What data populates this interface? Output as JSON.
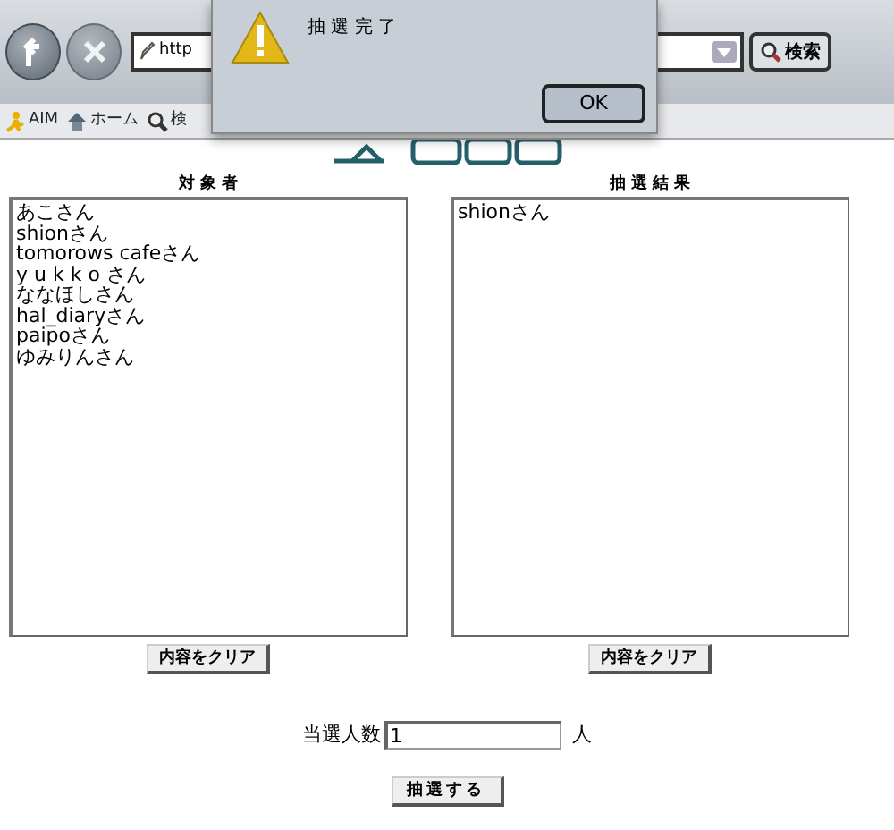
{
  "browser": {
    "address": "http",
    "search_button": "検索",
    "bookmarks": [
      {
        "label": "AIM",
        "kind": "runner"
      },
      {
        "label": "ホーム",
        "kind": "home"
      },
      {
        "label": "検",
        "kind": "search"
      }
    ]
  },
  "dialog": {
    "message": "抽 選 完 了",
    "button": "OK"
  },
  "candidates": {
    "heading": "対 象 者",
    "names": [
      "あこさん",
      "shionさん",
      "tomorows cafeさん",
      "y u k k o さん",
      "ななほしさん",
      "hal_diaryさん",
      "paipoさん",
      "ゆみりんさん"
    ],
    "clear_button": "内容をクリア"
  },
  "results": {
    "heading": "抽 選 結 果",
    "names": [
      "shionさん"
    ],
    "clear_button": "内容をクリア"
  },
  "count": {
    "label": "当選人数",
    "value": "1",
    "unit": "人"
  },
  "draw_button": "抽選する"
}
